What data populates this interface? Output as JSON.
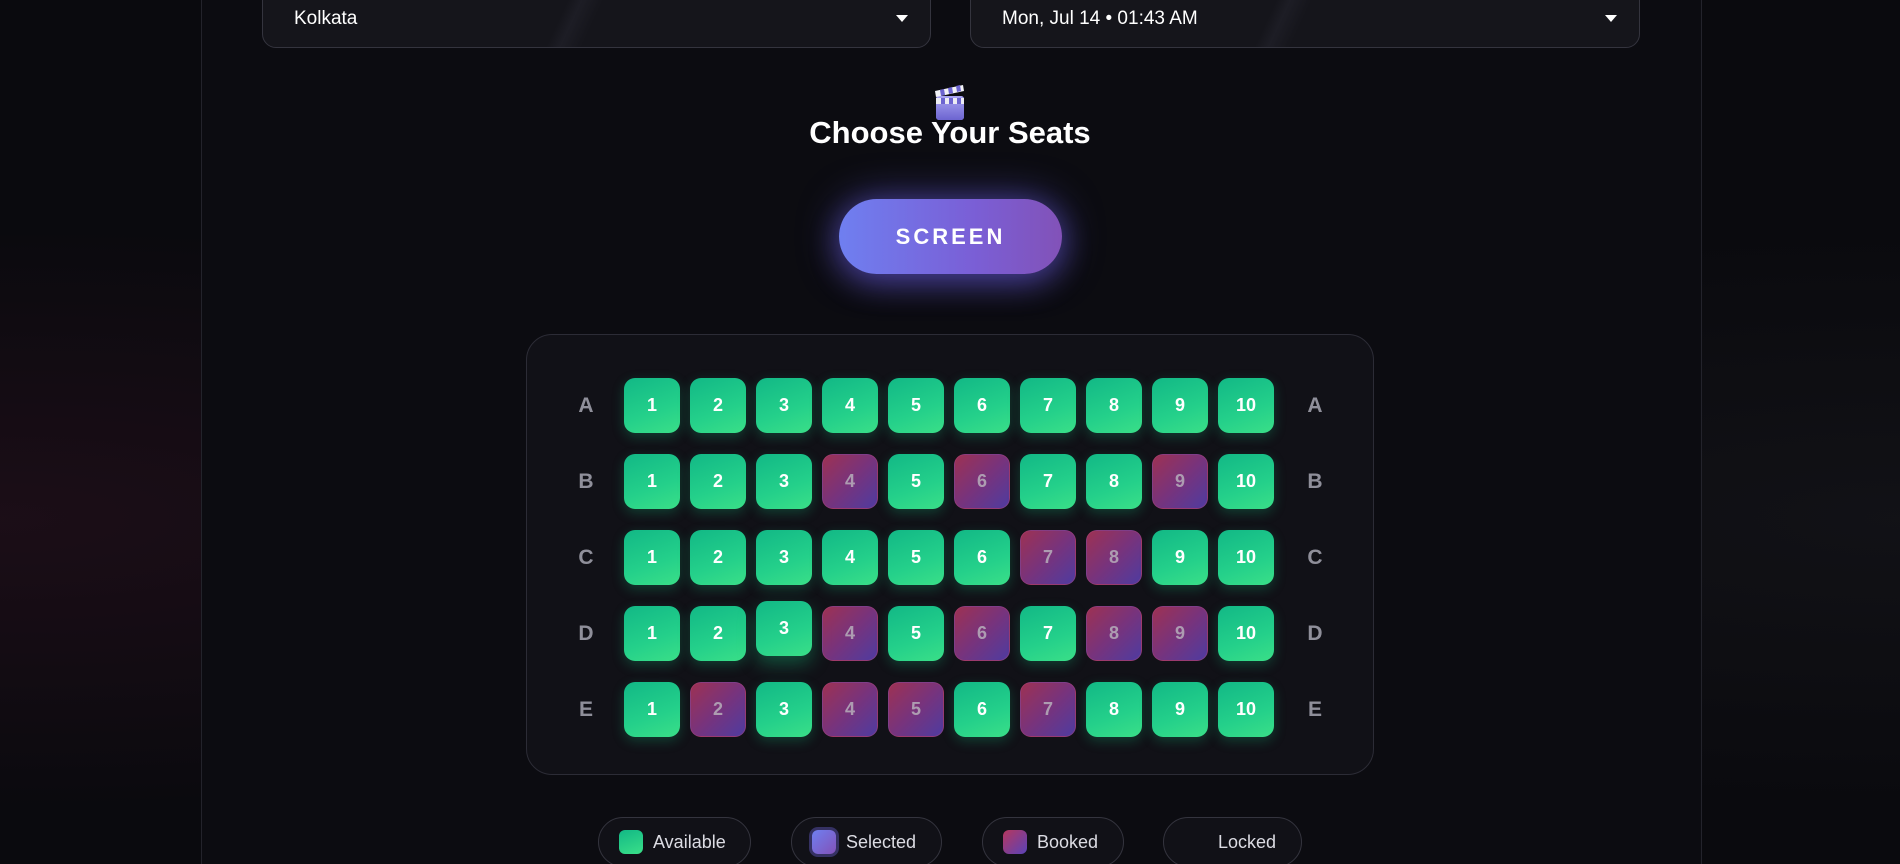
{
  "filters": {
    "city": "Kolkata",
    "datetime": "Mon, Jul 14 • 01:43 AM"
  },
  "heading": {
    "icon": "clapperboard-icon",
    "title": "Choose Your Seats"
  },
  "screen_label": "SCREEN",
  "colors": {
    "available": "#24d08a",
    "selected": "#7a6fe8",
    "booked": "#9a3a7e",
    "screen_gradient_start": "#6f7ff0",
    "screen_gradient_end": "#8252b8"
  },
  "seat_map": {
    "rows": [
      {
        "label": "A",
        "seats": [
          {
            "number": "1",
            "status": "available"
          },
          {
            "number": "2",
            "status": "available"
          },
          {
            "number": "3",
            "status": "available"
          },
          {
            "number": "4",
            "status": "available"
          },
          {
            "number": "5",
            "status": "available"
          },
          {
            "number": "6",
            "status": "available"
          },
          {
            "number": "7",
            "status": "available"
          },
          {
            "number": "8",
            "status": "available"
          },
          {
            "number": "9",
            "status": "available"
          },
          {
            "number": "10",
            "status": "available"
          }
        ]
      },
      {
        "label": "B",
        "seats": [
          {
            "number": "1",
            "status": "available"
          },
          {
            "number": "2",
            "status": "available"
          },
          {
            "number": "3",
            "status": "available"
          },
          {
            "number": "4",
            "status": "booked"
          },
          {
            "number": "5",
            "status": "available"
          },
          {
            "number": "6",
            "status": "booked"
          },
          {
            "number": "7",
            "status": "available"
          },
          {
            "number": "8",
            "status": "available"
          },
          {
            "number": "9",
            "status": "booked"
          },
          {
            "number": "10",
            "status": "available"
          }
        ]
      },
      {
        "label": "C",
        "seats": [
          {
            "number": "1",
            "status": "available"
          },
          {
            "number": "2",
            "status": "available"
          },
          {
            "number": "3",
            "status": "available"
          },
          {
            "number": "4",
            "status": "available"
          },
          {
            "number": "5",
            "status": "available"
          },
          {
            "number": "6",
            "status": "available"
          },
          {
            "number": "7",
            "status": "booked"
          },
          {
            "number": "8",
            "status": "booked"
          },
          {
            "number": "9",
            "status": "available"
          },
          {
            "number": "10",
            "status": "available"
          }
        ]
      },
      {
        "label": "D",
        "seats": [
          {
            "number": "1",
            "status": "available"
          },
          {
            "number": "2",
            "status": "available"
          },
          {
            "number": "3",
            "status": "available",
            "hovered": true
          },
          {
            "number": "4",
            "status": "booked"
          },
          {
            "number": "5",
            "status": "available"
          },
          {
            "number": "6",
            "status": "booked"
          },
          {
            "number": "7",
            "status": "available"
          },
          {
            "number": "8",
            "status": "booked"
          },
          {
            "number": "9",
            "status": "booked"
          },
          {
            "number": "10",
            "status": "available"
          }
        ]
      },
      {
        "label": "E",
        "seats": [
          {
            "number": "1",
            "status": "available"
          },
          {
            "number": "2",
            "status": "booked"
          },
          {
            "number": "3",
            "status": "available"
          },
          {
            "number": "4",
            "status": "booked"
          },
          {
            "number": "5",
            "status": "booked"
          },
          {
            "number": "6",
            "status": "available"
          },
          {
            "number": "7",
            "status": "booked"
          },
          {
            "number": "8",
            "status": "available"
          },
          {
            "number": "9",
            "status": "available"
          },
          {
            "number": "10",
            "status": "available"
          }
        ]
      }
    ]
  },
  "legend": [
    {
      "label": "Available",
      "status": "available"
    },
    {
      "label": "Selected",
      "status": "selected"
    },
    {
      "label": "Booked",
      "status": "booked"
    },
    {
      "label": "Locked",
      "status": "locked"
    }
  ]
}
